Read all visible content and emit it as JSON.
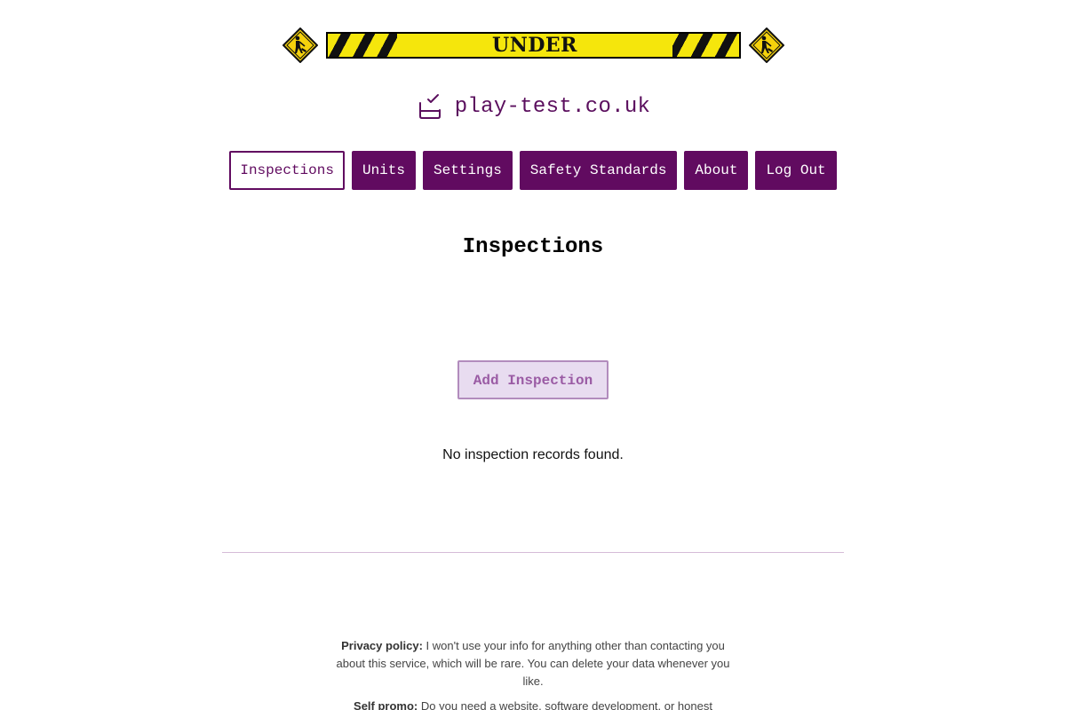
{
  "banner": {
    "text": "UNDER CONSTRUCTION",
    "colors": {
      "tape_yellow": "#f5e60c",
      "tape_black": "#111111"
    }
  },
  "brand": {
    "icon": "checkbox-tray-icon",
    "name": "play-test.co.uk",
    "color": "#5b0f5e"
  },
  "nav": {
    "items": [
      {
        "label": "Inspections",
        "active": true
      },
      {
        "label": "Units",
        "active": false
      },
      {
        "label": "Settings",
        "active": false
      },
      {
        "label": "Safety Standards",
        "active": false
      },
      {
        "label": "About",
        "active": false
      },
      {
        "label": "Log Out",
        "active": false
      }
    ],
    "accent": "#610b60"
  },
  "main": {
    "title": "Inspections",
    "add_button_label": "Add Inspection",
    "empty_message": "No inspection records found."
  },
  "footer": {
    "privacy_label": "Privacy policy:",
    "privacy_text": " I won't use your info for anything other than contacting you about this service, which will be rare. You can delete your data whenever you like.",
    "promo_label": "Self promo:",
    "promo_text": " Do you need a website, software development, or honest"
  }
}
